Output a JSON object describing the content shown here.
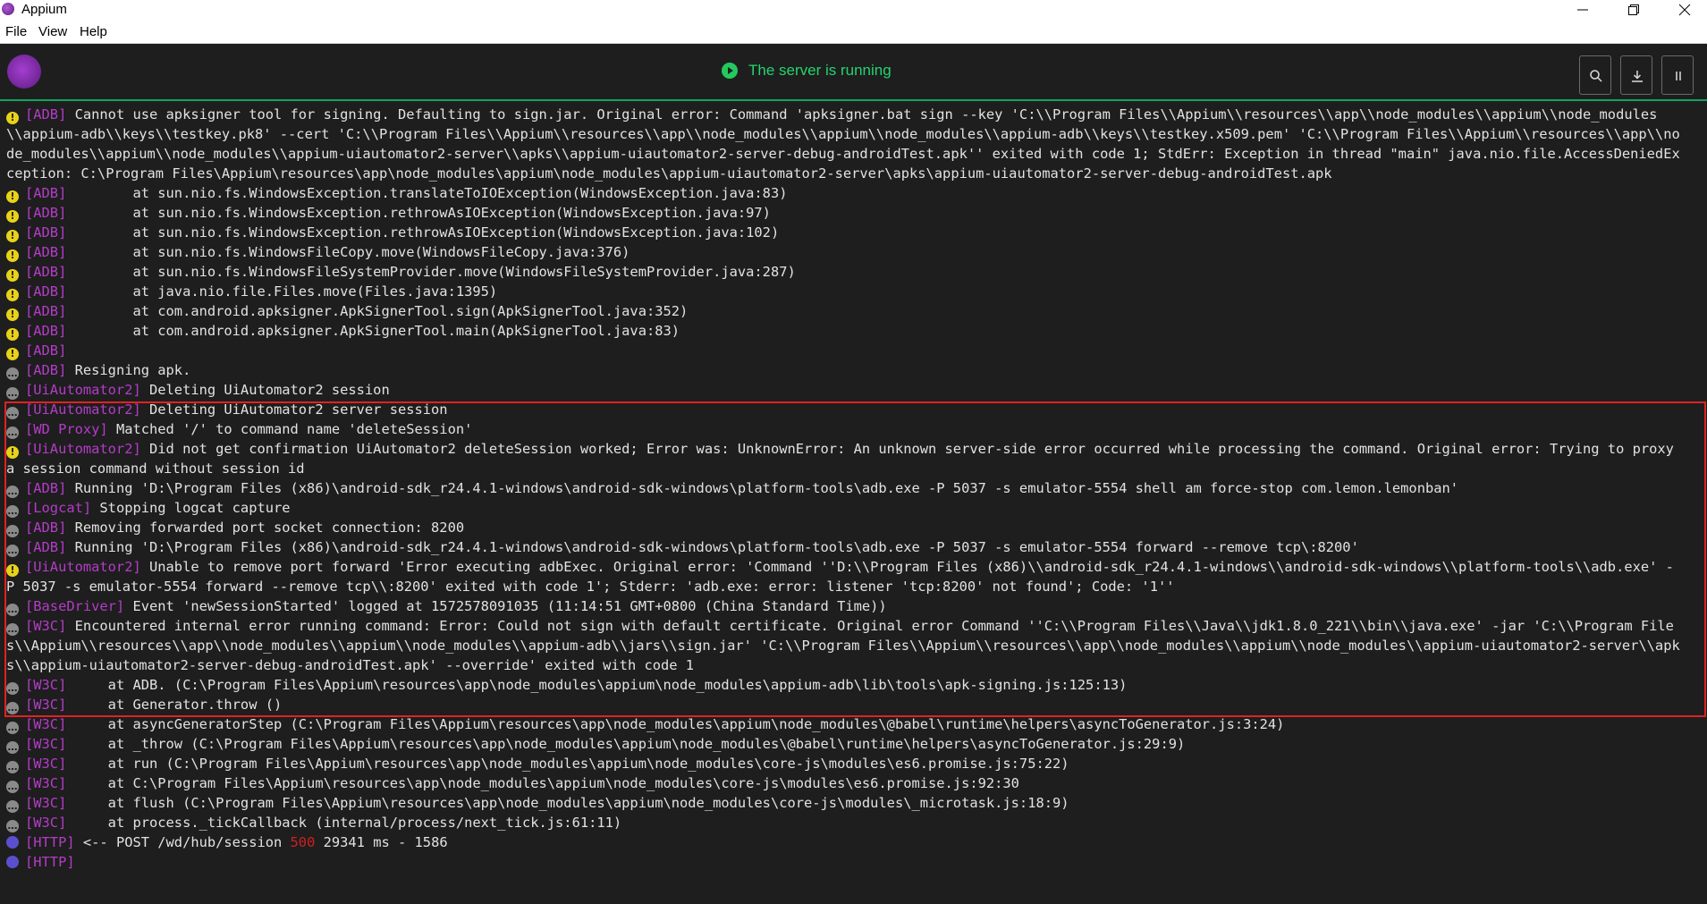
{
  "window": {
    "title": "Appium"
  },
  "menu": {
    "file": "File",
    "view": "View",
    "help": "Help"
  },
  "header": {
    "status_text": "The server is running"
  },
  "log_entries": [
    {
      "level": "warn",
      "tag": "[ADB]",
      "text": " Cannot use apksigner tool for signing. Defaulting to sign.jar. Original error: Command 'apksigner.bat sign --key 'C:\\\\Program Files\\\\Appium\\\\resources\\\\app\\\\node_modules\\\\appium\\\\node_modules\\\\appium-adb\\\\keys\\\\testkey.pk8' --cert 'C:\\\\Program Files\\\\Appium\\\\resources\\\\app\\\\node_modules\\\\appium\\\\node_modules\\\\appium-adb\\\\keys\\\\testkey.x509.pem' 'C:\\\\Program Files\\\\Appium\\\\resources\\\\app\\\\node_modules\\\\appium\\\\node_modules\\\\appium-uiautomator2-server\\\\apks\\\\appium-uiautomator2-server-debug-androidTest.apk'' exited with code 1; StdErr: Exception in thread \"main\" java.nio.file.AccessDeniedException: C:\\Program Files\\Appium\\resources\\app\\node_modules\\appium\\node_modules\\appium-uiautomator2-server\\apks\\appium-uiautomator2-server-debug-androidTest.apk"
    },
    {
      "level": "warn",
      "tag": "[ADB]",
      "text": "        at sun.nio.fs.WindowsException.translateToIOException(WindowsException.java:83)"
    },
    {
      "level": "warn",
      "tag": "[ADB]",
      "text": "        at sun.nio.fs.WindowsException.rethrowAsIOException(WindowsException.java:97)"
    },
    {
      "level": "warn",
      "tag": "[ADB]",
      "text": "        at sun.nio.fs.WindowsException.rethrowAsIOException(WindowsException.java:102)"
    },
    {
      "level": "warn",
      "tag": "[ADB]",
      "text": "        at sun.nio.fs.WindowsFileCopy.move(WindowsFileCopy.java:376)"
    },
    {
      "level": "warn",
      "tag": "[ADB]",
      "text": "        at sun.nio.fs.WindowsFileSystemProvider.move(WindowsFileSystemProvider.java:287)"
    },
    {
      "level": "warn",
      "tag": "[ADB]",
      "text": "        at java.nio.file.Files.move(Files.java:1395)"
    },
    {
      "level": "warn",
      "tag": "[ADB]",
      "text": "        at com.android.apksigner.ApkSignerTool.sign(ApkSignerTool.java:352)"
    },
    {
      "level": "warn",
      "tag": "[ADB]",
      "text": "        at com.android.apksigner.ApkSignerTool.main(ApkSignerTool.java:83)"
    },
    {
      "level": "warn",
      "tag": "[ADB]",
      "text": ""
    },
    {
      "level": "info",
      "tag": "[ADB]",
      "text": " Resigning apk."
    },
    {
      "level": "info",
      "tag": "[UiAutomator2]",
      "text": " Deleting UiAutomator2 session"
    },
    {
      "level": "info",
      "tag": "[UiAutomator2]",
      "text": " Deleting UiAutomator2 server session"
    },
    {
      "level": "info",
      "tag": "[WD Proxy]",
      "text": " Matched '/' to command name 'deleteSession'"
    },
    {
      "level": "warn",
      "tag": "[UiAutomator2]",
      "text": " Did not get confirmation UiAutomator2 deleteSession worked; Error was: UnknownError: An unknown server-side error occurred while processing the command. Original error: Trying to proxy a session command without session id"
    },
    {
      "level": "info",
      "tag": "[ADB]",
      "text": " Running 'D:\\Program Files (x86)\\android-sdk_r24.4.1-windows\\android-sdk-windows\\platform-tools\\adb.exe -P 5037 -s emulator-5554 shell am force-stop com.lemon.lemonban'"
    },
    {
      "level": "info",
      "tag": "[Logcat]",
      "text": " Stopping logcat capture"
    },
    {
      "level": "info",
      "tag": "[ADB]",
      "text": " Removing forwarded port socket connection: 8200"
    },
    {
      "level": "info",
      "tag": "[ADB]",
      "text": " Running 'D:\\Program Files (x86)\\android-sdk_r24.4.1-windows\\android-sdk-windows\\platform-tools\\adb.exe -P 5037 -s emulator-5554 forward --remove tcp\\:8200'"
    },
    {
      "level": "warn",
      "tag": "[UiAutomator2]",
      "text": " Unable to remove port forward 'Error executing adbExec. Original error: 'Command ''D:\\\\Program Files (x86)\\\\android-sdk_r24.4.1-windows\\\\android-sdk-windows\\\\platform-tools\\\\adb.exe' -P 5037 -s emulator-5554 forward --remove tcp\\\\:8200' exited with code 1'; Stderr: 'adb.exe: error: listener 'tcp:8200' not found'; Code: '1''"
    },
    {
      "level": "info",
      "tag": "[BaseDriver]",
      "text": " Event 'newSessionStarted' logged at 1572578091035 (11:14:51 GMT+0800 (China Standard Time))"
    },
    {
      "level": "info",
      "tag": "[W3C]",
      "text": " Encountered internal error running command: Error: Could not sign with default certificate. Original error Command ''C:\\\\Program Files\\\\Java\\\\jdk1.8.0_221\\\\bin\\\\java.exe' -jar 'C:\\\\Program Files\\\\Appium\\\\resources\\\\app\\\\node_modules\\\\appium\\\\node_modules\\\\appium-adb\\\\jars\\\\sign.jar' 'C:\\\\Program Files\\\\Appium\\\\resources\\\\app\\\\node_modules\\\\appium\\\\node_modules\\\\appium-uiautomator2-server\\\\apks\\\\appium-uiautomator2-server-debug-androidTest.apk' --override' exited with code 1"
    },
    {
      "level": "info",
      "tag": "[W3C]",
      "text": "     at ADB. (C:\\Program Files\\Appium\\resources\\app\\node_modules\\appium\\node_modules\\appium-adb\\lib\\tools\\apk-signing.js:125:13)"
    },
    {
      "level": "info",
      "tag": "[W3C]",
      "text": "     at Generator.throw ()"
    },
    {
      "level": "info",
      "tag": "[W3C]",
      "text": "     at asyncGeneratorStep (C:\\Program Files\\Appium\\resources\\app\\node_modules\\appium\\node_modules\\@babel\\runtime\\helpers\\asyncToGenerator.js:3:24)"
    },
    {
      "level": "info",
      "tag": "[W3C]",
      "text": "     at _throw (C:\\Program Files\\Appium\\resources\\app\\node_modules\\appium\\node_modules\\@babel\\runtime\\helpers\\asyncToGenerator.js:29:9)"
    },
    {
      "level": "info",
      "tag": "[W3C]",
      "text": "     at run (C:\\Program Files\\Appium\\resources\\app\\node_modules\\appium\\node_modules\\core-js\\modules\\es6.promise.js:75:22)"
    },
    {
      "level": "info",
      "tag": "[W3C]",
      "text": "     at C:\\Program Files\\Appium\\resources\\app\\node_modules\\appium\\node_modules\\core-js\\modules\\es6.promise.js:92:30"
    },
    {
      "level": "info",
      "tag": "[W3C]",
      "text": "     at flush (C:\\Program Files\\Appium\\resources\\app\\node_modules\\appium\\node_modules\\core-js\\modules\\_microtask.js:18:9)"
    },
    {
      "level": "info",
      "tag": "[W3C]",
      "text": "     at process._tickCallback (internal/process/next_tick.js:61:11)"
    },
    {
      "level": "http",
      "tag": "[HTTP]",
      "text": " <-- POST /wd/hub/session ",
      "status": "500",
      "after": " 29341 ms - 1586"
    },
    {
      "level": "http",
      "tag": "[HTTP]",
      "text": ""
    }
  ]
}
